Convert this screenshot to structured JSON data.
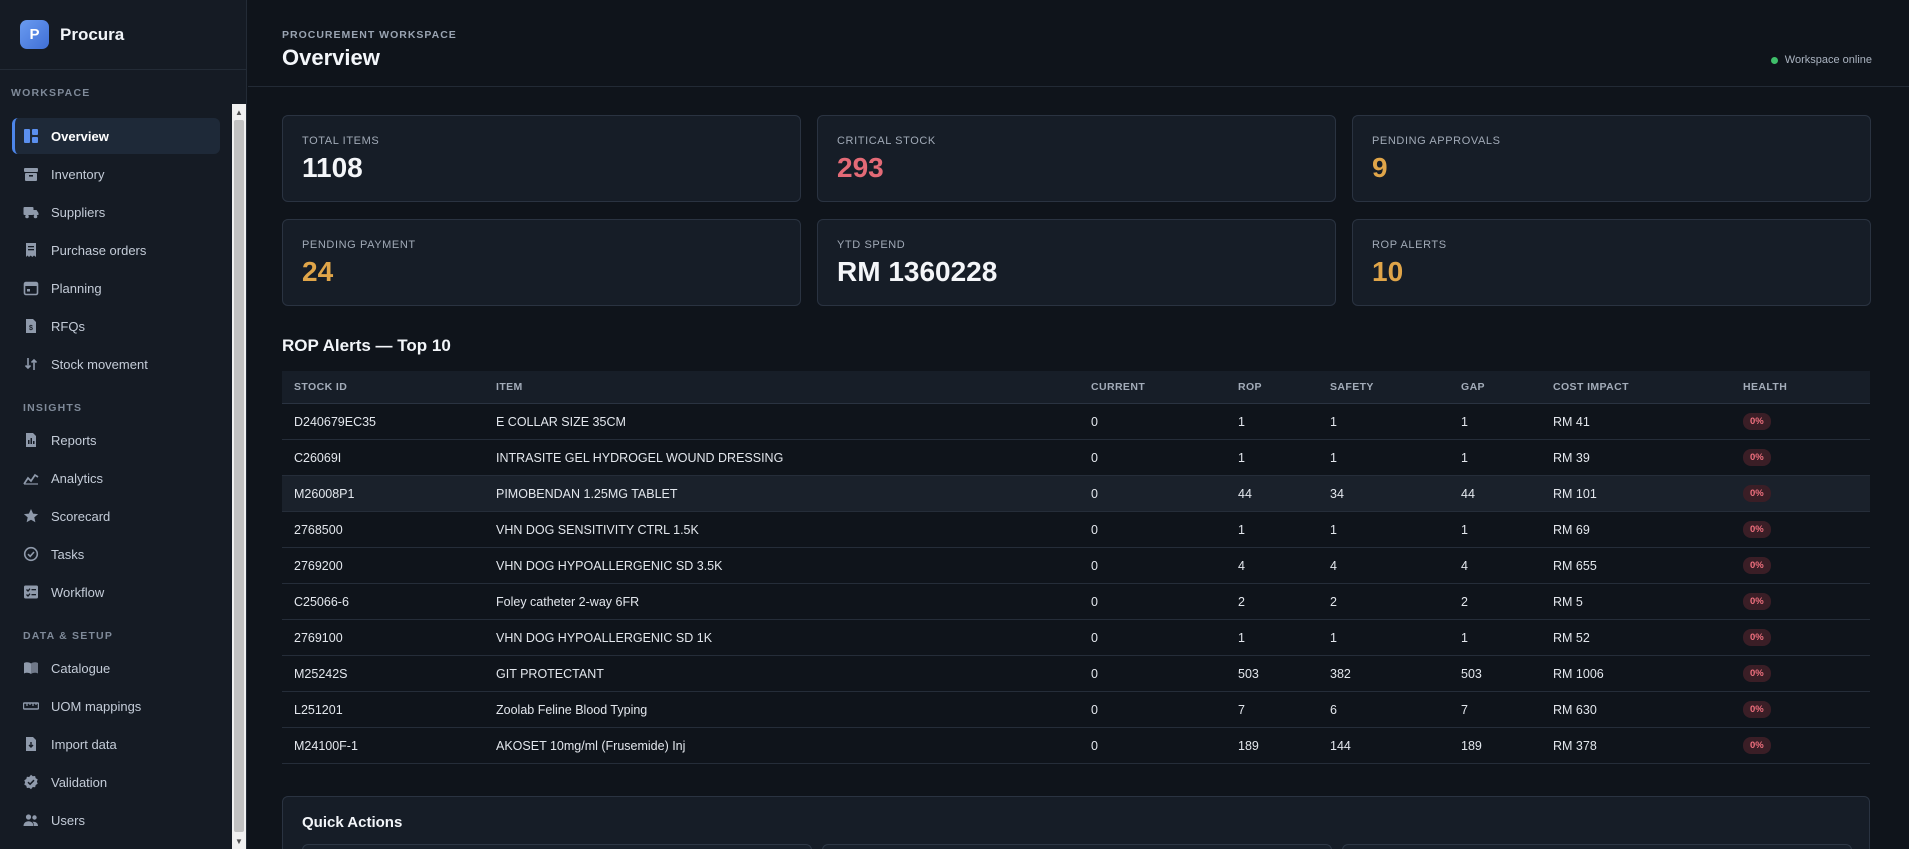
{
  "brand": {
    "logo_letter": "P",
    "name": "Procura"
  },
  "sidebar": {
    "sections": [
      {
        "label": "Workspace"
      },
      {
        "label": "Insights"
      },
      {
        "label": "Data & Setup"
      }
    ],
    "items": [
      {
        "label": "Overview",
        "icon": "dashboard-icon",
        "active": true
      },
      {
        "label": "Inventory",
        "icon": "archive-icon"
      },
      {
        "label": "Suppliers",
        "icon": "truck-icon"
      },
      {
        "label": "Purchase orders",
        "icon": "receipt-icon"
      },
      {
        "label": "Planning",
        "icon": "calendar-icon"
      },
      {
        "label": "RFQs",
        "icon": "document-icon"
      },
      {
        "label": "Stock movement",
        "icon": "arrows-updown-icon"
      },
      {
        "label": "Reports",
        "icon": "report-icon"
      },
      {
        "label": "Analytics",
        "icon": "chart-line-icon"
      },
      {
        "label": "Scorecard",
        "icon": "star-icon"
      },
      {
        "label": "Tasks",
        "icon": "check-circle-icon"
      },
      {
        "label": "Workflow",
        "icon": "checklist-icon"
      },
      {
        "label": "Catalogue",
        "icon": "book-icon"
      },
      {
        "label": "UOM mappings",
        "icon": "ruler-icon"
      },
      {
        "label": "Import data",
        "icon": "import-icon"
      },
      {
        "label": "Validation",
        "icon": "badge-check-icon"
      },
      {
        "label": "Users",
        "icon": "users-icon"
      }
    ]
  },
  "header": {
    "eyebrow": "PROCUREMENT WORKSPACE",
    "title": "Overview",
    "status": "Workspace online"
  },
  "stats": [
    {
      "label": "TOTAL ITEMS",
      "value": "1108"
    },
    {
      "label": "CRITICAL STOCK",
      "value": "293"
    },
    {
      "label": "PENDING APPROVALS",
      "value": "9"
    },
    {
      "label": "PENDING PAYMENT",
      "value": "24"
    },
    {
      "label": "YTD SPEND",
      "value": "RM 1360228"
    },
    {
      "label": "ROP ALERTS",
      "value": "10"
    }
  ],
  "colors": {
    "accent": "#4d86ea",
    "critical": "#e36a76",
    "warning": "#e0a549",
    "online": "#3fbf6a"
  },
  "rop": {
    "title": "ROP Alerts — Top 10",
    "columns": [
      "STOCK ID",
      "ITEM",
      "CURRENT",
      "ROP",
      "SAFETY",
      "GAP",
      "COST IMPACT",
      "HEALTH"
    ],
    "rows": [
      [
        "D240679EC35",
        "E COLLAR SIZE 35CM",
        "0",
        "1",
        "1",
        "1",
        "RM 41",
        "0%"
      ],
      [
        "C26069I",
        "INTRASITE GEL HYDROGEL WOUND DRESSING",
        "0",
        "1",
        "1",
        "1",
        "RM 39",
        "0%"
      ],
      [
        "M26008P1",
        "PIMOBENDAN 1.25MG TABLET",
        "0",
        "44",
        "34",
        "44",
        "RM 101",
        "0%"
      ],
      [
        "2768500",
        "VHN DOG SENSITIVITY CTRL 1.5K",
        "0",
        "1",
        "1",
        "1",
        "RM 69",
        "0%"
      ],
      [
        "2769200",
        "VHN DOG HYPOALLERGENIC SD 3.5K",
        "0",
        "4",
        "4",
        "4",
        "RM 655",
        "0%"
      ],
      [
        "C25066-6",
        "Foley catheter 2-way 6FR",
        "0",
        "2",
        "2",
        "2",
        "RM 5",
        "0%"
      ],
      [
        "2769100",
        "VHN DOG HYPOALLERGENIC SD 1K",
        "0",
        "1",
        "1",
        "1",
        "RM 52",
        "0%"
      ],
      [
        "M25242S",
        "GIT PROTECTANT",
        "0",
        "503",
        "382",
        "503",
        "RM 1006",
        "0%"
      ],
      [
        "L251201",
        "Zoolab Feline Blood Typing",
        "0",
        "7",
        "6",
        "7",
        "RM 630",
        "0%"
      ],
      [
        "M24100F-1",
        "AKOSET 10mg/ml (Frusemide) Inj",
        "0",
        "189",
        "144",
        "189",
        "RM 378",
        "0%"
      ]
    ]
  },
  "quick_actions": {
    "title": "Quick Actions"
  }
}
